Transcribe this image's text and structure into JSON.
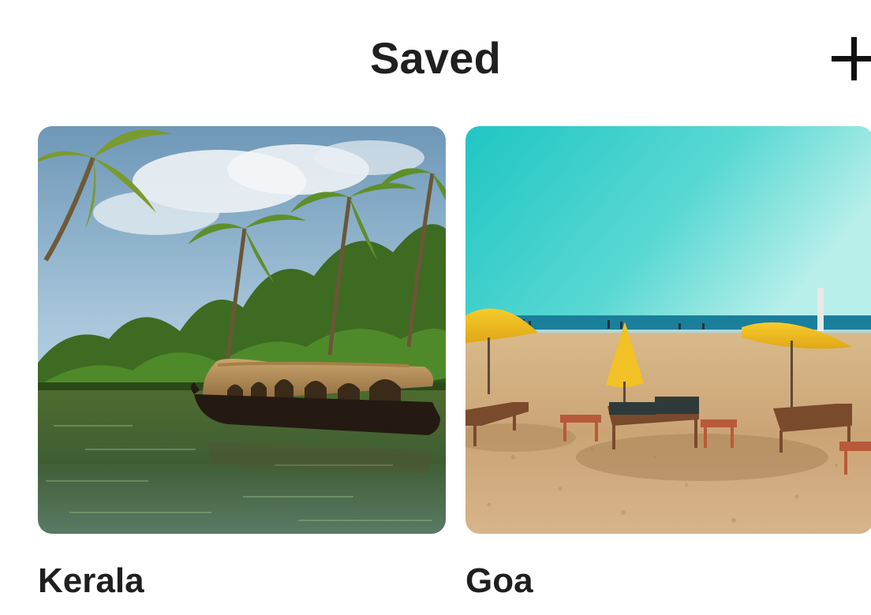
{
  "header": {
    "title": "Saved",
    "add_icon": "plus-icon"
  },
  "destinations": [
    {
      "name": "Kerala",
      "image": "backwaters-houseboat-palm-trees"
    },
    {
      "name": "Goa",
      "image": "beach-umbrellas-loungers"
    }
  ],
  "colors": {
    "text": "#1f1f1f",
    "background": "#ffffff"
  }
}
